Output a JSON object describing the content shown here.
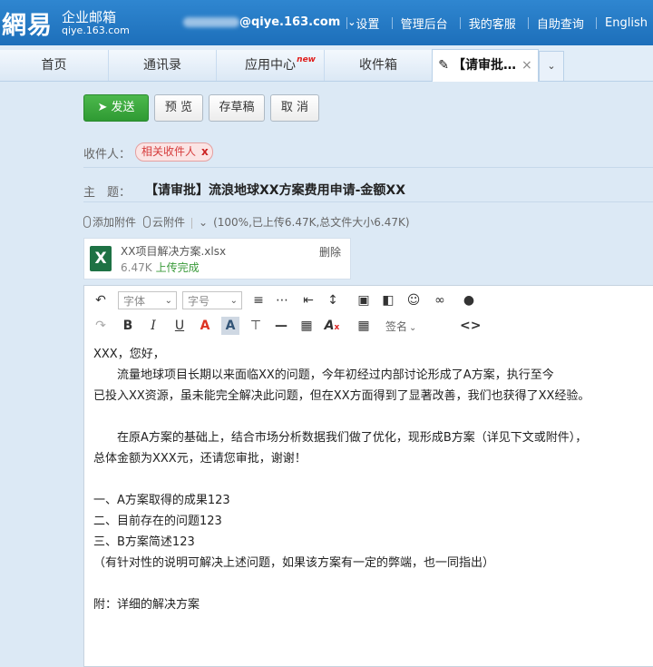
{
  "brand": {
    "logo": "網易",
    "name": "企业邮箱",
    "domain": "qiye.163.com"
  },
  "account": {
    "email_suffix": "@qiye.163.com"
  },
  "top_links": [
    "设置",
    "管理后台",
    "我的客服",
    "自助查询",
    "English"
  ],
  "tabs": [
    {
      "label": "首页"
    },
    {
      "label": "通讯录"
    },
    {
      "label": "应用中心",
      "badge": "new"
    },
    {
      "label": "收件箱"
    },
    {
      "label": "【请审批…"
    }
  ],
  "actions": {
    "send": "发送",
    "preview": "预 览",
    "draft": "存草稿",
    "cancel": "取 消"
  },
  "recipient": {
    "label": "收件人：",
    "chip": "相关收件人"
  },
  "subject": {
    "label": "主　题：",
    "value": "【请审批】流浪地球XX方案费用申请-金额XX"
  },
  "attach": {
    "add": "添加附件",
    "cloud": "云附件",
    "status": "(100%,已上传6.47K,总文件大小6.47K)"
  },
  "file": {
    "name": "XX项目解决方案.xlsx",
    "size": "6.47K",
    "status": "上传完成",
    "delete": "删除",
    "icon_letter": "X"
  },
  "editor": {
    "font": "字体",
    "size": "字号",
    "sign": "签名"
  },
  "body": [
    "XXX，您好，",
    "　　流量地球项目长期以来面临XX的问题，今年初经过内部讨论形成了A方案，执行至今",
    "已投入XX资源，虽未能完全解决此问题，但在XX方面得到了显著改善，我们也获得了XX经验。",
    "",
    "　　在原A方案的基础上，结合市场分析数据我们做了优化，现形成B方案（详见下文或附件），",
    "总体金额为XXX元，还请您审批，谢谢！",
    "",
    "一、A方案取得的成果123",
    "二、目前存在的问题123",
    "三、B方案简述123",
    "（有针对性的说明可解决上述问题，如果该方案有一定的弊端，也一同指出）",
    "",
    "附：详细的解决方案"
  ]
}
